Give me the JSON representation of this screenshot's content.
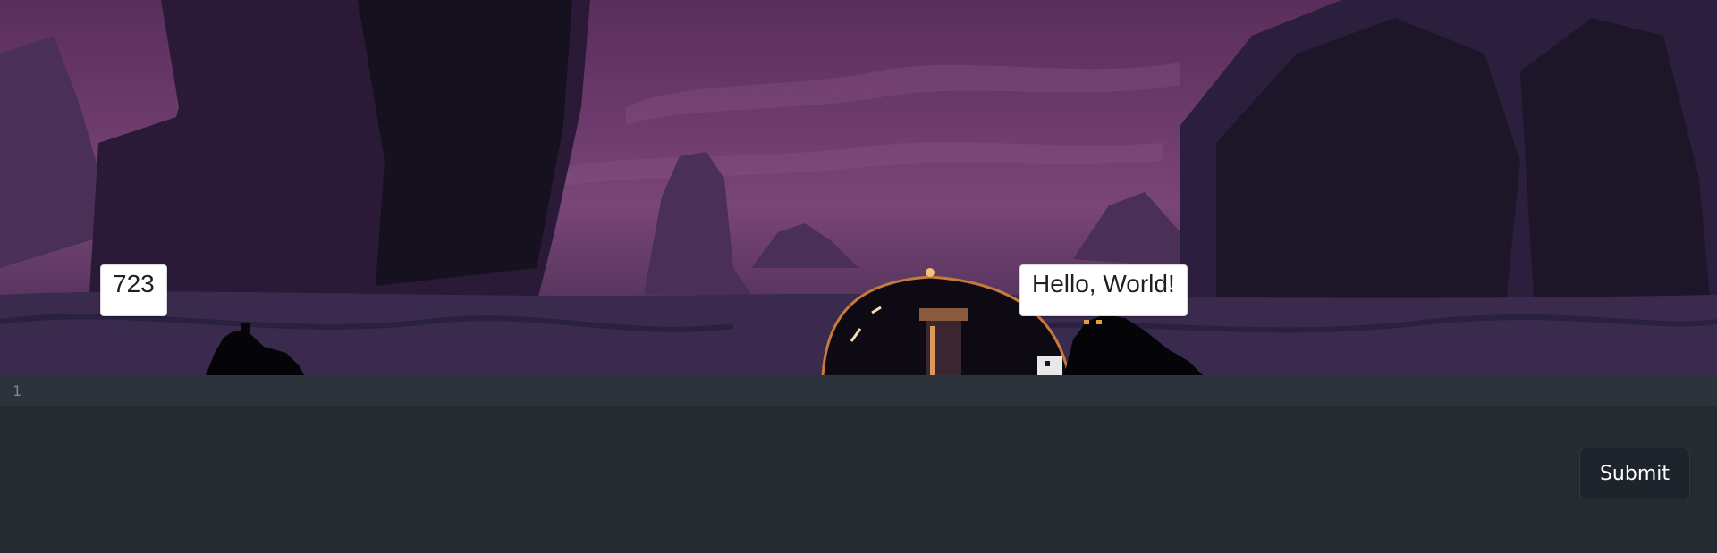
{
  "game": {
    "score_bubble": "723",
    "speech_bubble": "Hello, World!"
  },
  "editor": {
    "line_numbers": [
      "1"
    ],
    "code": ""
  },
  "actions": {
    "submit_label": "Submit"
  },
  "colors": {
    "sky": "#6b3a6a",
    "editor_background": "#262b32",
    "editor_active_line": "#2d333b",
    "button_background": "#1e242c"
  }
}
